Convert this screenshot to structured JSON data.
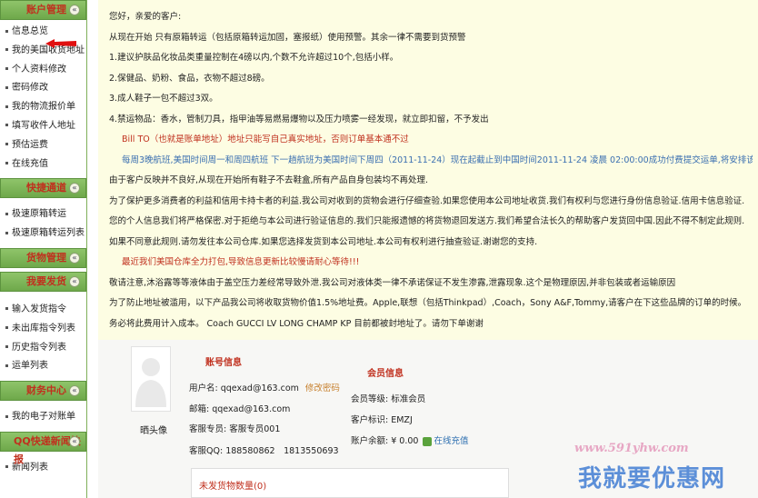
{
  "sidebar": {
    "sections": [
      {
        "title": "账户管理",
        "items": [
          "信息总览",
          "我的美国收货地址",
          "个人资料修改",
          "密码修改",
          "我的物流报价单",
          "填写收件人地址",
          "预估运费",
          "在线充值"
        ]
      },
      {
        "title": "快捷通道",
        "items": [
          "极速原箱转运",
          "极速原箱转运列表"
        ]
      },
      {
        "title": "货物管理",
        "items": []
      },
      {
        "title": "我要发货",
        "items": [
          "输入发货指令",
          "未出库指令列表",
          "历史指令列表",
          "运单列表"
        ]
      },
      {
        "title": "财务中心",
        "items": [
          "我的电子对账单"
        ]
      },
      {
        "title": "QQ快递新闻快报",
        "items": [
          "新闻列表"
        ]
      }
    ],
    "collapse_glyph": "«"
  },
  "notice": {
    "greeting": "您好，亲爱的客户:",
    "line1": "从现在开始 只有原箱转运（包括原箱转运加固，塞报纸）使用预警。其余一律不需要到货预警",
    "line2": "1.建议护肤品化妆品类重量控制在4磅以内,个数不允许超过10个,包括小样。",
    "line3": "2.保健品、奶粉、食品，衣物不超过8磅。",
    "line4": "3.成人鞋子一包不超过3双。",
    "line5": "4.禁运物品：香水，管制刀具，指甲油等易燃易爆物以及压力喷雾一经发现，就立即扣留，不予发出",
    "red1": "Bill TO（也就是账单地址）地址只能写自己真实地址，否则订单基本通不过",
    "blue1": "每周3晚航班,美国时间周一和周四航班 下一趟航班为美国时间下周四（2011-11-24）现在起截止到中国时间2011-11-24 凌晨 02:00:00成功付费提交运单,将安排该航班。",
    "line6": "由于客户反映并不良好,从现在开始所有鞋子不去鞋盒,所有产品自身包装均不再处理.",
    "line7": "为了保护更多消费者的利益和信用卡持卡者的利益.我公司对收到的货物会进行仔细查验.如果您使用本公司地址收货.我们有权利与您进行身份信息验证.信用卡信息验证.您的个人信息我们将严格保密.对于拒绝与本公司进行验证信息的.我们只能报遗憾的将货物退回发送方.我们希望合法长久的帮助客户发货回中国.因此不得不制定此规则.如果不同意此规则.请勿发往本公司仓库.如果您选择发货到本公司地址.本公司有权利进行抽查验证.谢谢您的支持.",
    "red2": "最近我们美国仓库全力打包,导致信息更新比较慢请耐心等待!!!",
    "line8": "敬请注意,沐浴露等等液体由于盖空压力差经常导致外泄.我公司对液体类一律不承诺保证不发生渗露,泄露现象.这个是物理原因,并非包装或者运输原因",
    "line9": "为了防止地址被滥用，以下产品我公司将收取货物价值1.5%地址费。Apple,联想（包括Thinkpad）,Coach，Sony A&F,Tommy,请客户在下这些品牌的订单的时候。务必将此费用计入成本。 Coach GUCCI LV LONG CHAMP KP 目前都被封地址了。请勿下单谢谢"
  },
  "account": {
    "avatar_label": "晒头像",
    "title": "账号信息",
    "username_label": "用户名:",
    "username": "qqexad@163.com",
    "change_password": "修改密码",
    "email_label": "邮箱:",
    "email": "qqexad@163.com",
    "cs_label": "客服专员:",
    "cs_value": "客服专员001",
    "qq_label": "客服QQ:",
    "qq_value": "188580862　1813550693"
  },
  "member": {
    "title": "会员信息",
    "level_label": "会员等级:",
    "level": "标准会员",
    "id_label": "客户标识:",
    "id": "EMZJ",
    "balance_label": "账户余额:",
    "balance": "¥ 0.00",
    "recharge": "在线充值"
  },
  "unshipped": "未发货物数量(0)",
  "watermark": {
    "url": "www.591yhw.com",
    "text": "我就要优惠网"
  },
  "colors": {
    "header_green": "#7cb652",
    "notice_bg": "#fdfde3",
    "accent_red": "#c0301e",
    "accent_blue": "#3a6fb0"
  }
}
